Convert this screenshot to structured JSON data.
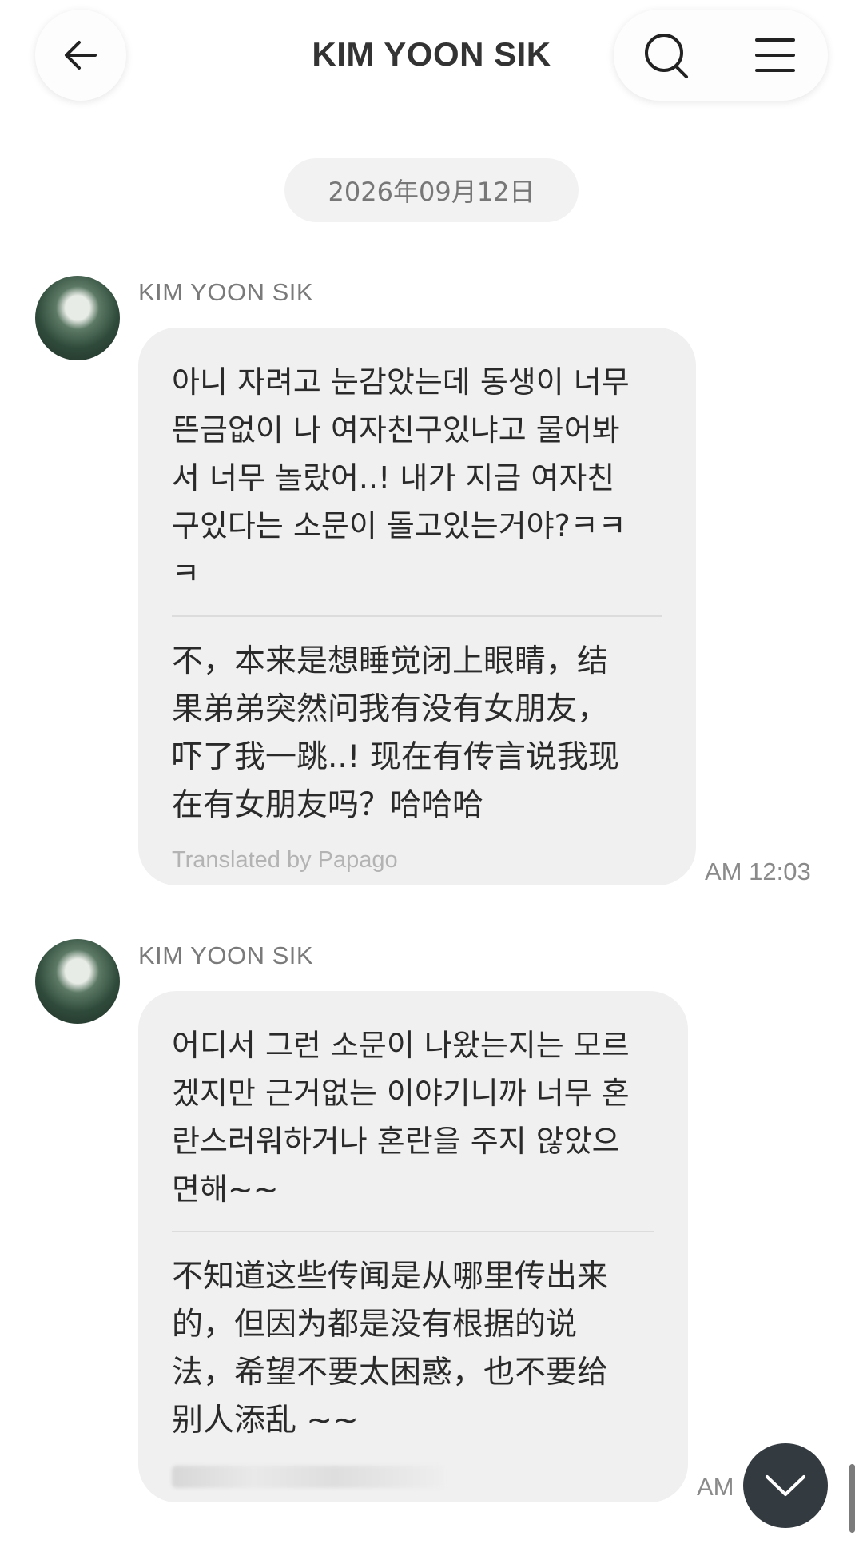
{
  "header": {
    "title": "KIM YOON SIK",
    "back_icon": "arrow-left-icon",
    "search_icon": "search-icon",
    "menu_icon": "hamburger-menu-icon"
  },
  "date_separator": "2026年09月12日",
  "messages": [
    {
      "sender": "KIM YOON SIK",
      "original_lines": [
        "아니 자려고 눈감았는데 동생이 너무",
        "뜬금없이 나 여자친구있냐고 물어봐",
        "서 너무 놀랐어..! 내가 지금 여자친",
        "구있다는 소문이 돌고있는거야?ㅋㅋ",
        "ㅋ"
      ],
      "translation_lines": [
        "不，本来是想睡觉闭上眼睛，结",
        "果弟弟突然问我有没有女朋友，",
        "吓了我一跳..! 现在有传言说我现",
        "在有女朋友吗？哈哈哈"
      ],
      "translation_credit": "Translated by Papago",
      "time": "AM 12:03"
    },
    {
      "sender": "KIM YOON SIK",
      "original_lines": [
        "어디서 그런 소문이 나왔는지는 모르",
        "겠지만 근거없는 이야기니까 너무 혼",
        "란스러워하거나 혼란을 주지 않았으",
        "면해~~"
      ],
      "translation_lines": [
        "不知道这些传闻是从哪里传出来",
        "的，但因为都是没有根据的说",
        "法，希望不要太困惑，也不要给",
        "别人添乱 ~~"
      ],
      "time": "AM"
    }
  ],
  "scroll_down_icon": "chevron-down-icon"
}
